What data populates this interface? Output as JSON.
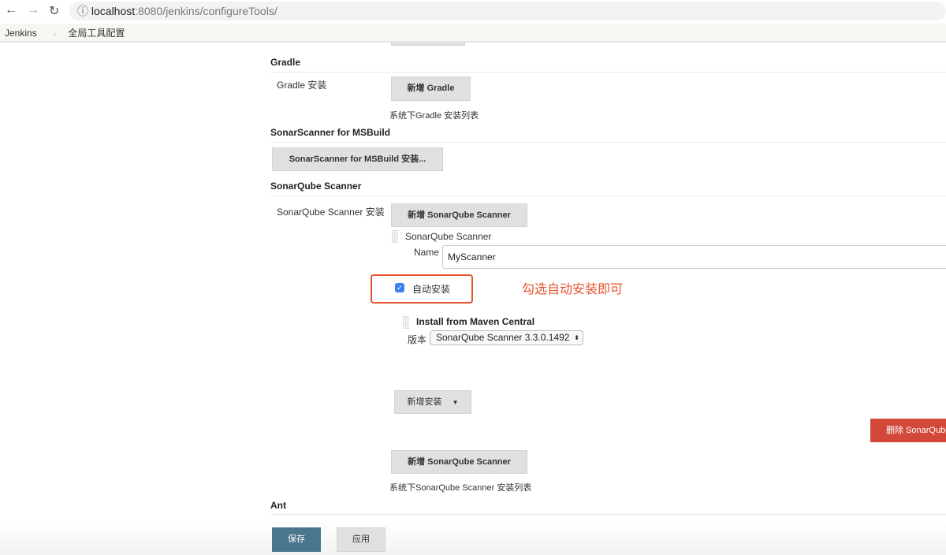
{
  "browser": {
    "url_host": "localhost",
    "url_path": ":8080/jenkins/configureTools/"
  },
  "breadcrumb": {
    "root": "Jenkins",
    "current": "全局工具配置"
  },
  "gradle": {
    "title": "Gradle",
    "label": "Gradle 安装",
    "add_button": "新增 Gradle",
    "description": "系统下Gradle 安装列表"
  },
  "msbuild": {
    "title": "SonarScanner for MSBuild",
    "install_button": "SonarScanner for MSBuild 安装..."
  },
  "sonar": {
    "title": "SonarQube Scanner",
    "label": "SonarQube Scanner 安装",
    "add_button": "新增 SonarQube Scanner",
    "item_title": "SonarQube Scanner",
    "name_label": "Name",
    "name_value": "MyScanner",
    "auto_install_label": "自动安装",
    "auto_install_checked": true,
    "annotation": "勾选自动安装即可",
    "installer_title": "Install from Maven Central",
    "version_label": "版本",
    "version_value": "SonarQube Scanner 3.3.0.1492",
    "add_installer_button": "新增安装",
    "delete_button": "删除 SonarQube Scanner",
    "add_button_2": "新增 SonarQube Scanner",
    "description": "系统下SonarQube Scanner 安装列表"
  },
  "ant": {
    "title": "Ant"
  },
  "footer": {
    "save": "保存",
    "apply": "应用"
  },
  "colors": {
    "annotation": "#e8542f",
    "delete": "#d24939",
    "save": "#4b758b"
  }
}
